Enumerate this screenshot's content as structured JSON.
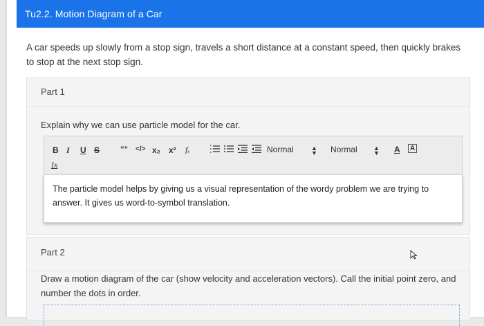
{
  "header": {
    "title": "Tu2.2. Motion Diagram of a Car"
  },
  "prompt": "A car speeds up slowly from a stop sign, travels a short distance at a constant speed, then quickly brakes to stop at the next stop sign.",
  "part1": {
    "label": "Part 1",
    "question": "Explain why we can use particle model for the car.",
    "toolbar": {
      "bold": "B",
      "italic": "I",
      "underline": "U",
      "strike": "S",
      "quote": "””",
      "code": "</>",
      "subscript": "x₂",
      "superscript": "x²",
      "formula": "fₓ",
      "ordered_list": "☰",
      "bullet_list": "☰",
      "outdent": "☰",
      "indent": "☰",
      "format_select": "Normal",
      "size_select": "Normal",
      "font_color": "A",
      "bg_color": "A",
      "clear_format": "Ix"
    },
    "answer": "The particle model helps by giving us a visual representation of the wordy problem we are trying to answer. It gives us word-to-symbol translation."
  },
  "part2": {
    "label": "Part 2",
    "question": "Draw a motion diagram of the car (show velocity and acceleration vectors). Call the initial point zero, and number the dots in order."
  },
  "colors": {
    "header_bg": "#1a73e8",
    "dashed_border": "#8aa7e6"
  }
}
